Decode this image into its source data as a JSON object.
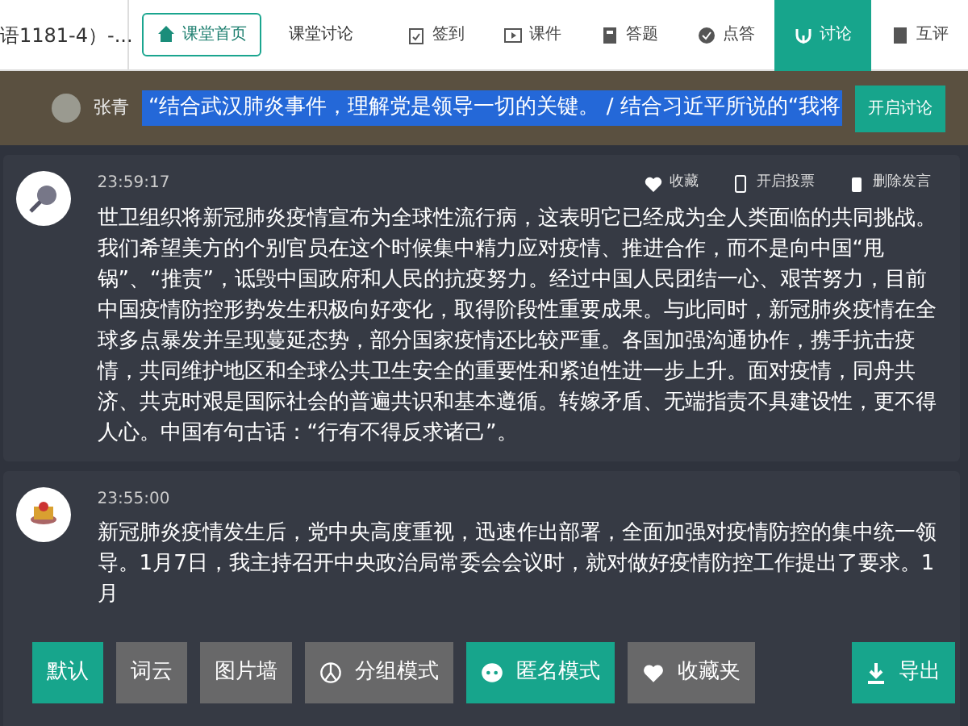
{
  "course": {
    "title": "语1181-4）-..."
  },
  "tabs": [
    {
      "label": "课堂首页",
      "selected": true
    },
    {
      "label": "课堂讨论",
      "selected": false
    }
  ],
  "nav": [
    {
      "label": "签到",
      "selected": false
    },
    {
      "label": "课件",
      "selected": false
    },
    {
      "label": "答题",
      "selected": false
    },
    {
      "label": "点答",
      "selected": false
    },
    {
      "label": "讨论",
      "selected": true
    },
    {
      "label": "互评",
      "selected": false
    }
  ],
  "topic": {
    "author": "张青",
    "text": "“结合武汉肺炎事件，理解党是领导一切的关键。 / 结合习近平所说的“我将",
    "button": "开启讨论"
  },
  "posts": [
    {
      "time": "23:59:17",
      "actions": [
        {
          "label": "收藏"
        },
        {
          "label": "开启投票"
        },
        {
          "label": "删除发言"
        }
      ],
      "text": "世卫组织将新冠肺炎疫情宣布为全球性流行病，这表明它已经成为全人类面临的共同挑战。我们希望美方的个别官员在这个时候集中精力应对疫情、推进合作，而不是向中国“甩锅”、“推责”，诋毁中国政府和人民的抗疫努力。经过中国人民团结一心、艰苦努力，目前中国疫情防控形势发生积极向好变化，取得阶段性重要成果。与此同时，新冠肺炎疫情在全球多点暴发并呈现蔓延态势，部分国家疫情还比较严重。各国加强沟通协作，携手抗击疫情，共同维护地区和全球公共卫生安全的重要性和紧迫性进一步上升。面对疫情，同舟共济、共克时艰是国际社会的普遍共识和基本遵循。转嫁矛盾、无端指责不具建设性，更不得人心。中国有句古话：“行有不得反求诸己”。"
    },
    {
      "time": "23:55:00",
      "text": "新冠肺炎疫情发生后，党中央高度重视，迅速作出部署，全面加强对疫情防控的集中统一领导。1月7日，我主持召开中央政治局常委会会议时，就对做好疫情防控工作提出了要求。1月"
    }
  ],
  "toolbar": [
    {
      "label": "默认",
      "selected": true
    },
    {
      "label": "词云",
      "selected": false
    },
    {
      "label": "图片墙",
      "selected": false
    },
    {
      "label": "分组模式",
      "selected": false
    },
    {
      "label": "匿名模式",
      "selected": true
    },
    {
      "label": "收藏夹",
      "selected": false
    }
  ],
  "export": {
    "label": "导出"
  }
}
